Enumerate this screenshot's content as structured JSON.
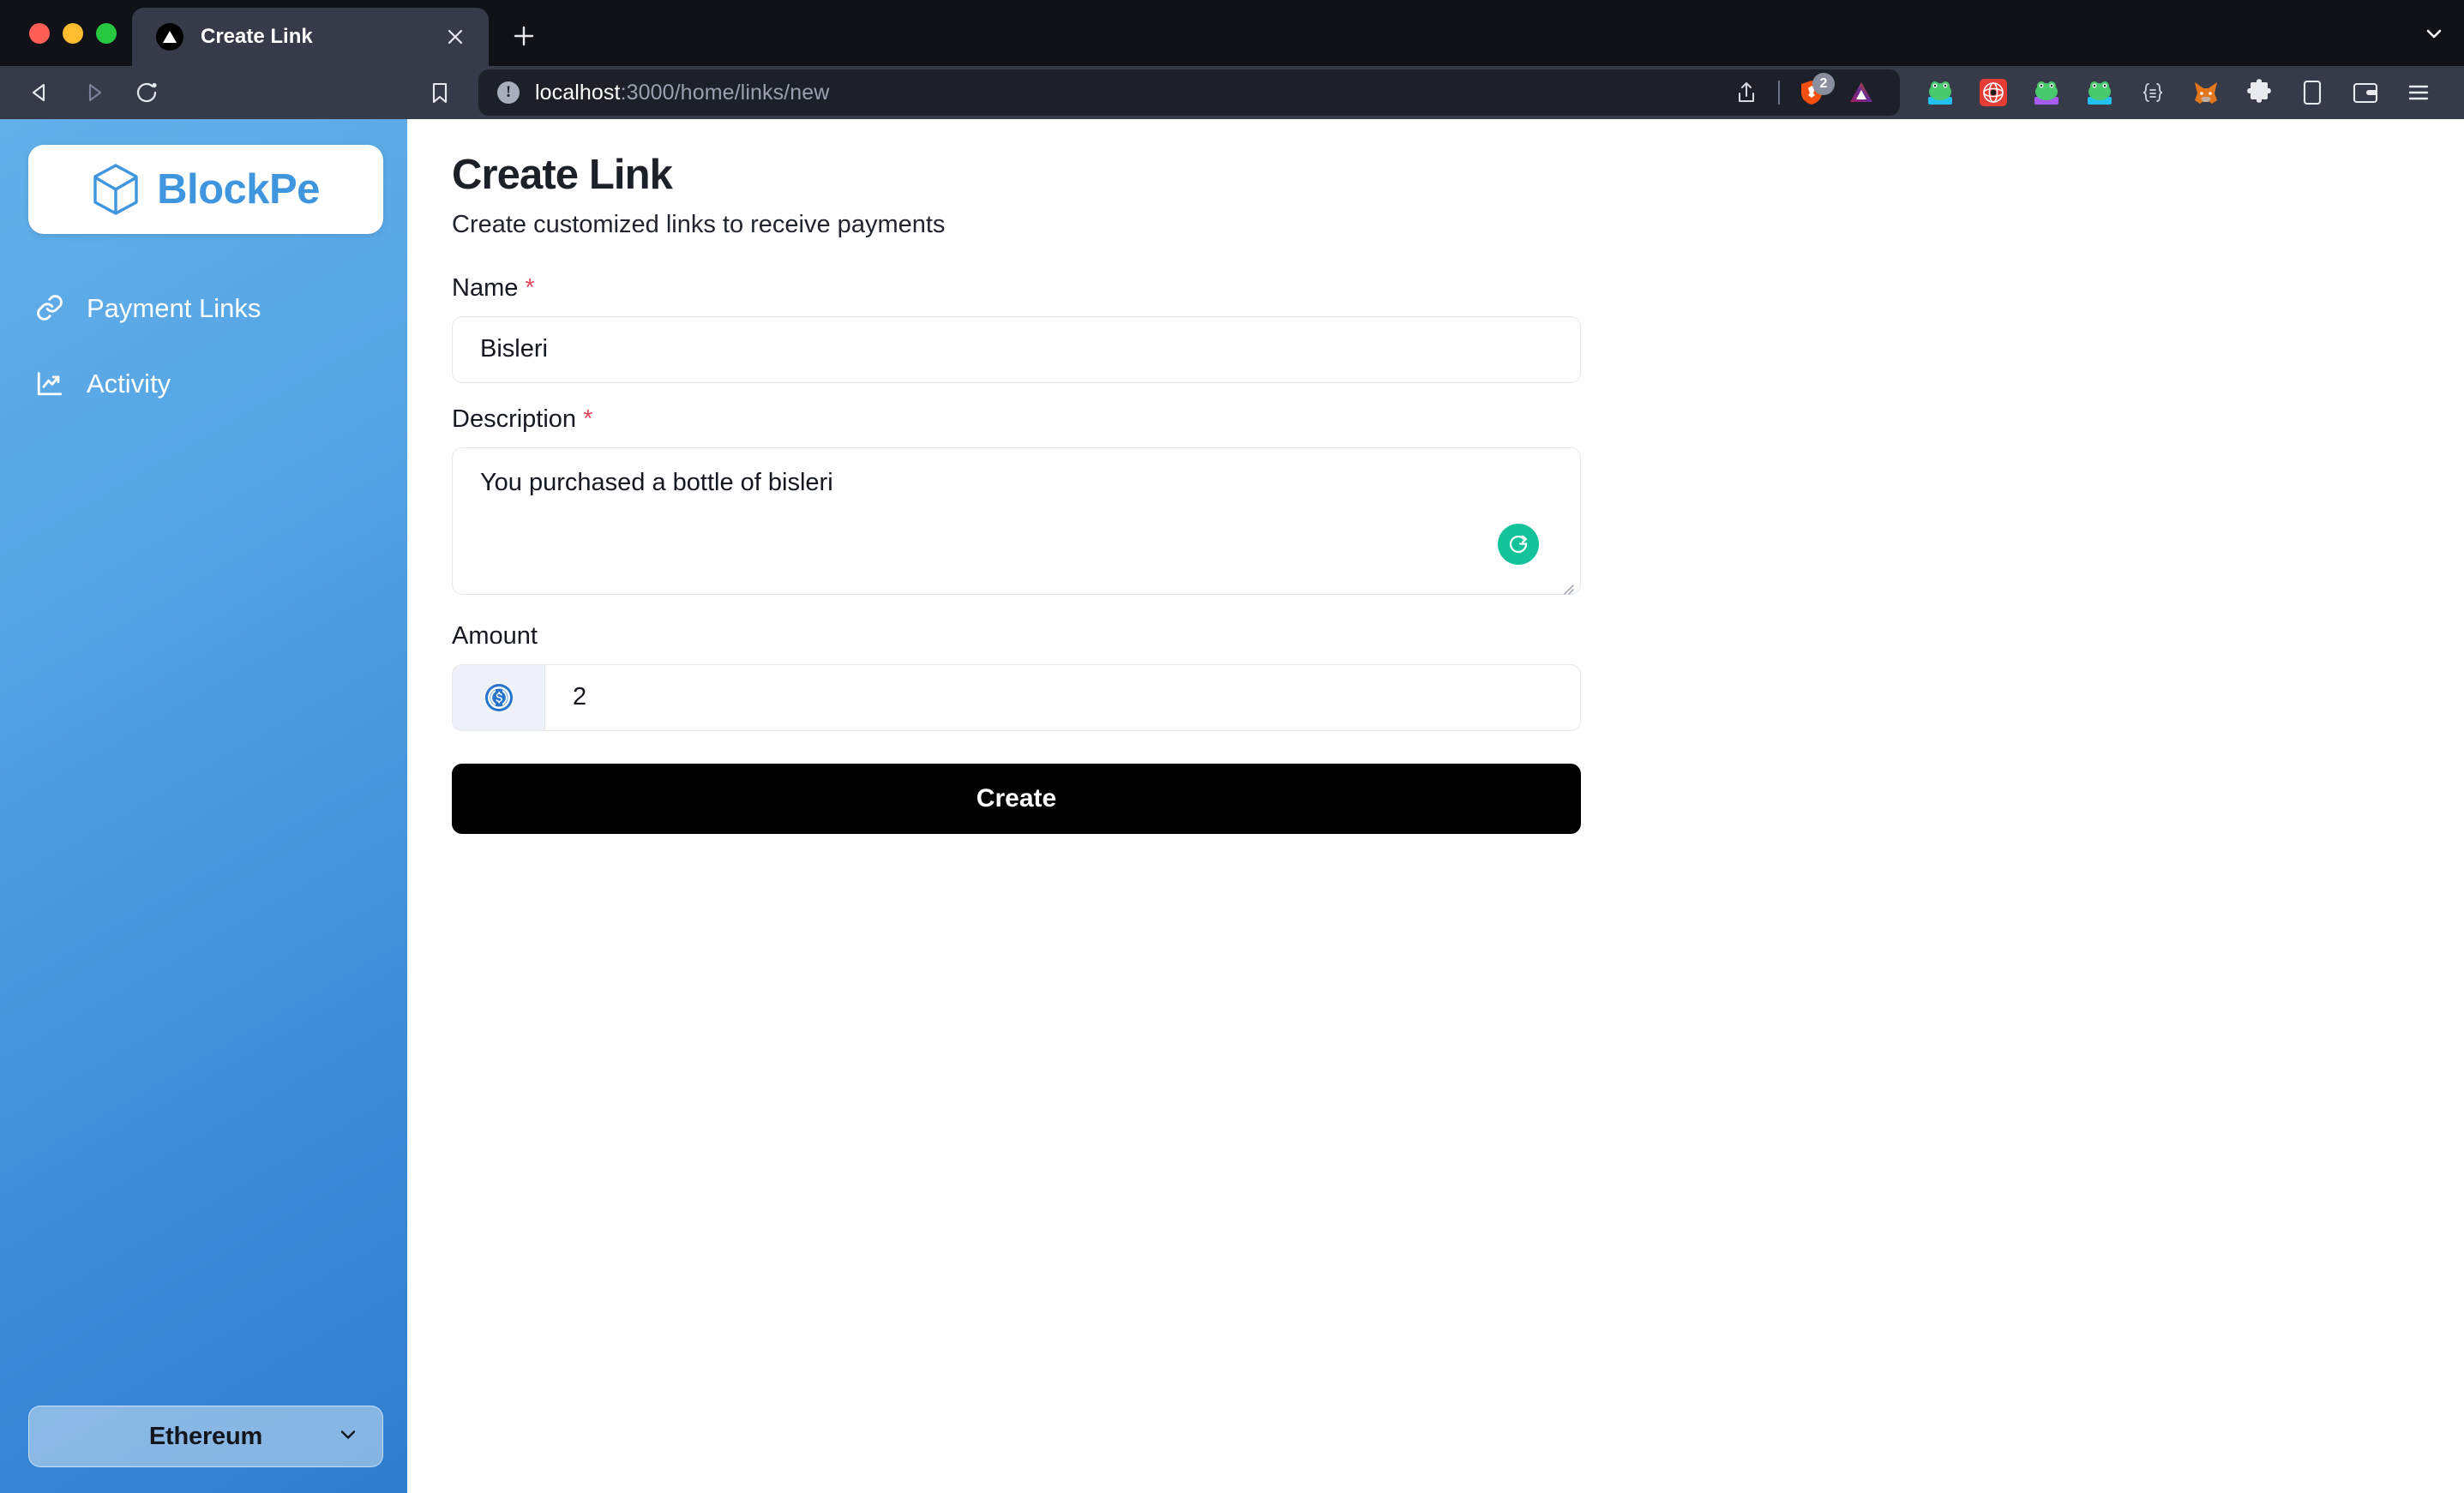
{
  "browser": {
    "tab": {
      "title": "Create Link",
      "favicon": "vercel-triangle-icon",
      "close": "×"
    },
    "new_tab_label": "+",
    "url": {
      "host": "localhost",
      "path": ":3000/home/links/new",
      "full": "localhost:3000/home/links/new"
    },
    "brave_shields_count": "2",
    "toolbar_icons": [
      "back-icon",
      "forward-icon",
      "reload-icon",
      "bookmark-icon",
      "share-icon",
      "brave-shields-icon",
      "brave-rewards-icon"
    ],
    "extension_icons": [
      "phantom-frog-blue-icon",
      "rabby-wallet-icon",
      "phantom-frog-purple-icon",
      "phantom-frog-cyan-icon",
      "json-formatter-icon",
      "metamask-fox-icon",
      "extensions-puzzle-icon",
      "sidebar-panel-icon",
      "wallet-icon",
      "browser-menu-icon"
    ]
  },
  "sidebar": {
    "logo": {
      "text": "BlockPe",
      "icon": "cube-icon",
      "color": "#3f96de"
    },
    "items": [
      {
        "label": "Payment Links",
        "icon": "link-icon"
      },
      {
        "label": "Activity",
        "icon": "chart-line-up-icon"
      }
    ],
    "network": {
      "value": "Ethereum",
      "chevron": "chevron-down-icon"
    }
  },
  "main": {
    "title": "Create Link",
    "subtitle": "Create customized links to receive payments",
    "fields": {
      "name": {
        "label": "Name",
        "required": true,
        "required_mark": "*",
        "value": "Bisleri"
      },
      "description": {
        "label": "Description",
        "required": true,
        "required_mark": "*",
        "value": "You purchased a bottle of bisleri",
        "assistant_icon": "grammarly-icon",
        "assistant_color": "#15c39a"
      },
      "amount": {
        "label": "Amount",
        "required": false,
        "value": "2",
        "currency_icon": "usdc-coin-icon",
        "currency_color": "#2775ca"
      }
    },
    "submit": {
      "label": "Create"
    }
  }
}
